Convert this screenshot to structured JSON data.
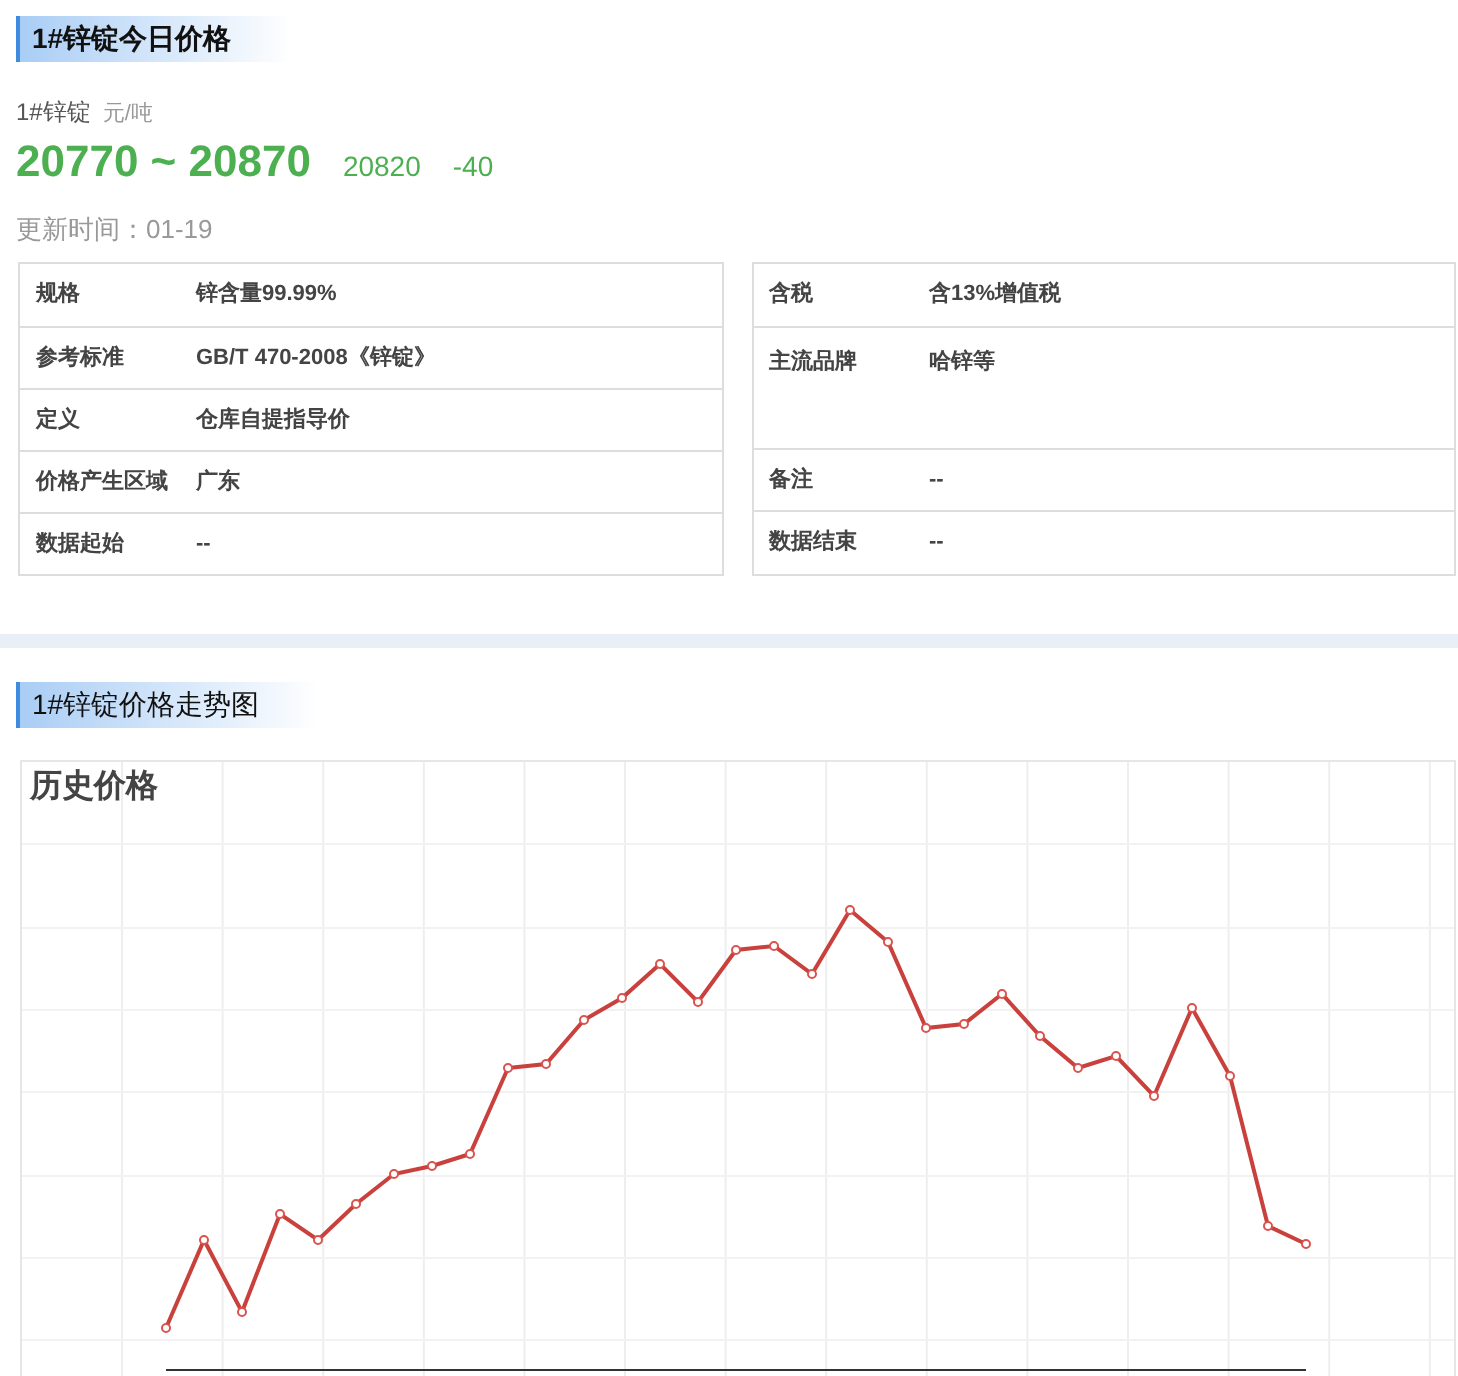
{
  "today": {
    "heading": "1#锌锭今日价格",
    "product": "1#锌锭",
    "unit": "元/吨",
    "range": "20770 ~ 20870",
    "average": "20820",
    "change": "-40",
    "updated": "更新时间：01-19"
  },
  "specs_left": [
    {
      "label": "规格",
      "value": "锌含量99.99%"
    },
    {
      "label": "参考标准",
      "value": "GB/T 470-2008《锌锭》"
    },
    {
      "label": "定义",
      "value": "仓库自提指导价"
    },
    {
      "label": "价格产生区域",
      "value": "广东"
    },
    {
      "label": "数据起始",
      "value": "--"
    }
  ],
  "specs_right": [
    {
      "label": "含税",
      "value": "含13%增值税"
    },
    {
      "label": "主流品牌",
      "value": "哈锌等",
      "tall": true
    },
    {
      "label": "备注",
      "value": "--"
    },
    {
      "label": "数据结束",
      "value": "--"
    }
  ],
  "trend": {
    "heading": "1#锌锭价格走势图",
    "chart_title": "历史价格"
  }
}
